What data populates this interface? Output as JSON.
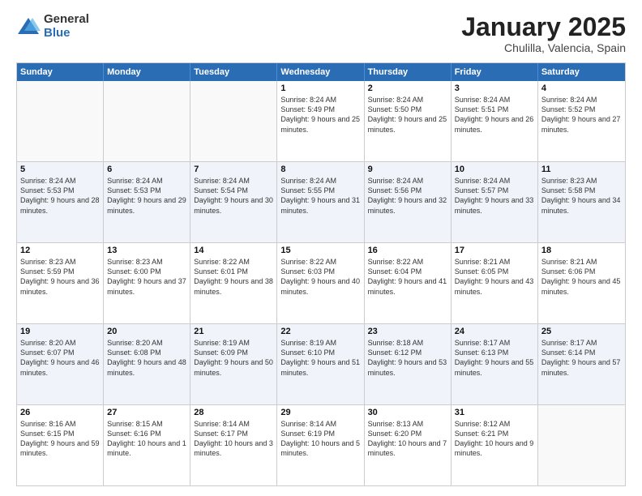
{
  "logo": {
    "general": "General",
    "blue": "Blue"
  },
  "header": {
    "month": "January 2025",
    "location": "Chulilla, Valencia, Spain"
  },
  "days_of_week": [
    "Sunday",
    "Monday",
    "Tuesday",
    "Wednesday",
    "Thursday",
    "Friday",
    "Saturday"
  ],
  "weeks": [
    [
      {
        "day": "",
        "text": ""
      },
      {
        "day": "",
        "text": ""
      },
      {
        "day": "",
        "text": ""
      },
      {
        "day": "1",
        "text": "Sunrise: 8:24 AM\nSunset: 5:49 PM\nDaylight: 9 hours and 25 minutes."
      },
      {
        "day": "2",
        "text": "Sunrise: 8:24 AM\nSunset: 5:50 PM\nDaylight: 9 hours and 25 minutes."
      },
      {
        "day": "3",
        "text": "Sunrise: 8:24 AM\nSunset: 5:51 PM\nDaylight: 9 hours and 26 minutes."
      },
      {
        "day": "4",
        "text": "Sunrise: 8:24 AM\nSunset: 5:52 PM\nDaylight: 9 hours and 27 minutes."
      }
    ],
    [
      {
        "day": "5",
        "text": "Sunrise: 8:24 AM\nSunset: 5:53 PM\nDaylight: 9 hours and 28 minutes."
      },
      {
        "day": "6",
        "text": "Sunrise: 8:24 AM\nSunset: 5:53 PM\nDaylight: 9 hours and 29 minutes."
      },
      {
        "day": "7",
        "text": "Sunrise: 8:24 AM\nSunset: 5:54 PM\nDaylight: 9 hours and 30 minutes."
      },
      {
        "day": "8",
        "text": "Sunrise: 8:24 AM\nSunset: 5:55 PM\nDaylight: 9 hours and 31 minutes."
      },
      {
        "day": "9",
        "text": "Sunrise: 8:24 AM\nSunset: 5:56 PM\nDaylight: 9 hours and 32 minutes."
      },
      {
        "day": "10",
        "text": "Sunrise: 8:24 AM\nSunset: 5:57 PM\nDaylight: 9 hours and 33 minutes."
      },
      {
        "day": "11",
        "text": "Sunrise: 8:23 AM\nSunset: 5:58 PM\nDaylight: 9 hours and 34 minutes."
      }
    ],
    [
      {
        "day": "12",
        "text": "Sunrise: 8:23 AM\nSunset: 5:59 PM\nDaylight: 9 hours and 36 minutes."
      },
      {
        "day": "13",
        "text": "Sunrise: 8:23 AM\nSunset: 6:00 PM\nDaylight: 9 hours and 37 minutes."
      },
      {
        "day": "14",
        "text": "Sunrise: 8:22 AM\nSunset: 6:01 PM\nDaylight: 9 hours and 38 minutes."
      },
      {
        "day": "15",
        "text": "Sunrise: 8:22 AM\nSunset: 6:03 PM\nDaylight: 9 hours and 40 minutes."
      },
      {
        "day": "16",
        "text": "Sunrise: 8:22 AM\nSunset: 6:04 PM\nDaylight: 9 hours and 41 minutes."
      },
      {
        "day": "17",
        "text": "Sunrise: 8:21 AM\nSunset: 6:05 PM\nDaylight: 9 hours and 43 minutes."
      },
      {
        "day": "18",
        "text": "Sunrise: 8:21 AM\nSunset: 6:06 PM\nDaylight: 9 hours and 45 minutes."
      }
    ],
    [
      {
        "day": "19",
        "text": "Sunrise: 8:20 AM\nSunset: 6:07 PM\nDaylight: 9 hours and 46 minutes."
      },
      {
        "day": "20",
        "text": "Sunrise: 8:20 AM\nSunset: 6:08 PM\nDaylight: 9 hours and 48 minutes."
      },
      {
        "day": "21",
        "text": "Sunrise: 8:19 AM\nSunset: 6:09 PM\nDaylight: 9 hours and 50 minutes."
      },
      {
        "day": "22",
        "text": "Sunrise: 8:19 AM\nSunset: 6:10 PM\nDaylight: 9 hours and 51 minutes."
      },
      {
        "day": "23",
        "text": "Sunrise: 8:18 AM\nSunset: 6:12 PM\nDaylight: 9 hours and 53 minutes."
      },
      {
        "day": "24",
        "text": "Sunrise: 8:17 AM\nSunset: 6:13 PM\nDaylight: 9 hours and 55 minutes."
      },
      {
        "day": "25",
        "text": "Sunrise: 8:17 AM\nSunset: 6:14 PM\nDaylight: 9 hours and 57 minutes."
      }
    ],
    [
      {
        "day": "26",
        "text": "Sunrise: 8:16 AM\nSunset: 6:15 PM\nDaylight: 9 hours and 59 minutes."
      },
      {
        "day": "27",
        "text": "Sunrise: 8:15 AM\nSunset: 6:16 PM\nDaylight: 10 hours and 1 minute."
      },
      {
        "day": "28",
        "text": "Sunrise: 8:14 AM\nSunset: 6:17 PM\nDaylight: 10 hours and 3 minutes."
      },
      {
        "day": "29",
        "text": "Sunrise: 8:14 AM\nSunset: 6:19 PM\nDaylight: 10 hours and 5 minutes."
      },
      {
        "day": "30",
        "text": "Sunrise: 8:13 AM\nSunset: 6:20 PM\nDaylight: 10 hours and 7 minutes."
      },
      {
        "day": "31",
        "text": "Sunrise: 8:12 AM\nSunset: 6:21 PM\nDaylight: 10 hours and 9 minutes."
      },
      {
        "day": "",
        "text": ""
      }
    ]
  ]
}
